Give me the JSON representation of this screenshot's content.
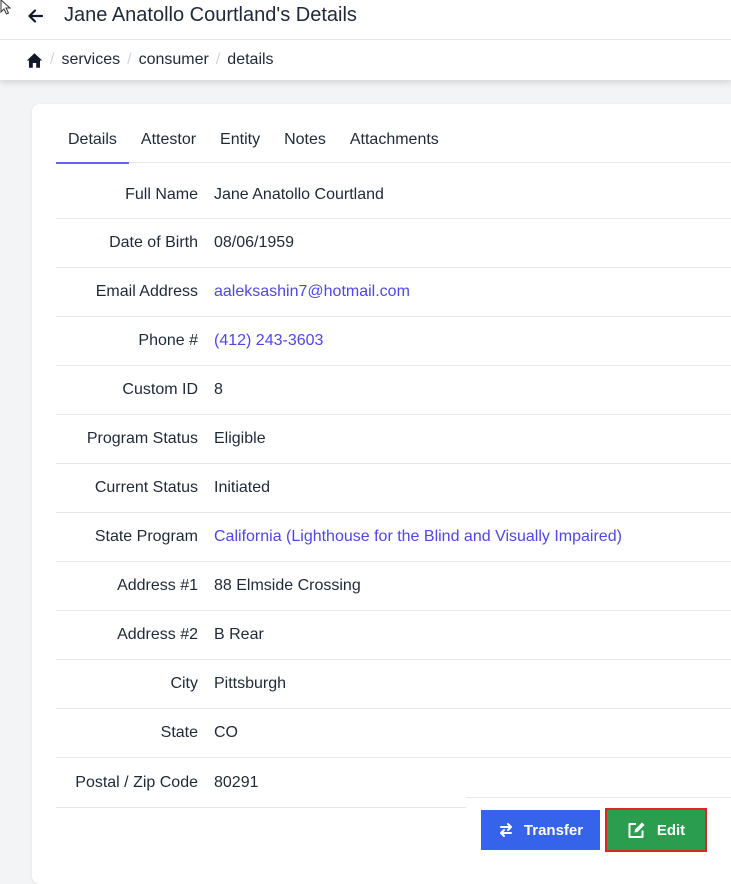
{
  "header": {
    "title": "Jane Anatollo Courtland's Details",
    "back_icon": "arrow-left-icon"
  },
  "breadcrumb": {
    "home_icon": "home-icon",
    "items": [
      "services",
      "consumer",
      "details"
    ]
  },
  "tabs": [
    {
      "label": "Details",
      "active": true
    },
    {
      "label": "Attestor",
      "active": false
    },
    {
      "label": "Entity",
      "active": false
    },
    {
      "label": "Notes",
      "active": false
    },
    {
      "label": "Attachments",
      "active": false
    }
  ],
  "details": [
    {
      "label": "Full Name",
      "value": "Jane Anatollo Courtland",
      "link": false
    },
    {
      "label": "Date of Birth",
      "value": "08/06/1959",
      "link": false
    },
    {
      "label": "Email Address",
      "value": "aaleksashin7@hotmail.com",
      "link": true
    },
    {
      "label": "Phone #",
      "value": "(412) 243-3603",
      "link": true
    },
    {
      "label": "Custom ID",
      "value": "8",
      "link": false
    },
    {
      "label": "Program Status",
      "value": "Eligible",
      "link": false
    },
    {
      "label": "Current Status",
      "value": "Initiated",
      "link": false
    },
    {
      "label": "State Program",
      "value": "California (Lighthouse for the Blind and Visually Impaired)",
      "link": true
    },
    {
      "label": "Address #1",
      "value": "88 Elmside Crossing",
      "link": false
    },
    {
      "label": "Address #2",
      "value": "B Rear",
      "link": false
    },
    {
      "label": "City",
      "value": "Pittsburgh",
      "link": false
    },
    {
      "label": "State",
      "value": "CO",
      "link": false
    },
    {
      "label": "Postal / Zip Code",
      "value": "80291",
      "link": false
    }
  ],
  "actions": {
    "transfer_label": "Transfer",
    "transfer_icon": "transfer-arrows-icon",
    "edit_label": "Edit",
    "edit_icon": "edit-icon"
  },
  "colors": {
    "accent": "#6366f1",
    "link": "#4f46e5",
    "transfer_button": "#3563e9",
    "edit_button": "#2a9d4f",
    "edit_highlight": "#dc2626"
  }
}
